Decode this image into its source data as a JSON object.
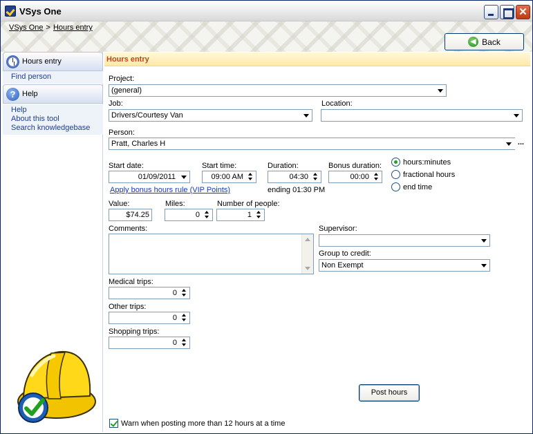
{
  "window": {
    "title": "VSys One"
  },
  "breadcrumb": {
    "home": "VSys One",
    "separator": ">",
    "current": "Hours entry"
  },
  "toolbar": {
    "back_label": "Back"
  },
  "sidebar": {
    "sections": [
      {
        "label": "Hours entry",
        "icon": "clock-icon",
        "links": [
          "Find person"
        ]
      },
      {
        "label": "Help",
        "icon": "help-icon",
        "links": [
          "Help",
          "About this tool",
          "Search knowledgebase"
        ]
      }
    ]
  },
  "page": {
    "title": "Hours entry"
  },
  "form": {
    "project": {
      "label": "Project:",
      "value": "(general)"
    },
    "job": {
      "label": "Job:",
      "value": "Drivers/Courtesy Van"
    },
    "location": {
      "label": "Location:",
      "value": ""
    },
    "person": {
      "label": "Person:",
      "value": "Pratt, Charles H",
      "browse_label": "..."
    },
    "start_date": {
      "label": "Start date:",
      "value": "01/09/2011"
    },
    "start_time": {
      "label": "Start time:",
      "value": "09:00 AM"
    },
    "duration": {
      "label": "Duration:",
      "value": "04:30",
      "ending_text": "ending 01:30 PM"
    },
    "bonus_duration": {
      "label": "Bonus duration:",
      "value": "00:00"
    },
    "duration_mode": {
      "options": [
        "hours:minutes",
        "fractional hours",
        "end time"
      ],
      "selected": "hours:minutes"
    },
    "bonus_rule_link": "Apply bonus hours rule (VIP Points)",
    "value": {
      "label": "Value:",
      "value": "$74.25"
    },
    "miles": {
      "label": "Miles:",
      "value": "0"
    },
    "number_of_people": {
      "label": "Number of people:",
      "value": "1"
    },
    "comments": {
      "label": "Comments:",
      "value": ""
    },
    "supervisor": {
      "label": "Supervisor:",
      "value": ""
    },
    "group_to_credit": {
      "label": "Group to credit:",
      "value": "Non Exempt"
    },
    "medical_trips": {
      "label": "Medical trips:",
      "value": "0"
    },
    "other_trips": {
      "label": "Other trips:",
      "value": "0"
    },
    "shopping_trips": {
      "label": "Shopping trips:",
      "value": "0"
    },
    "post_label": "Post hours",
    "warn": {
      "label": "Warn when posting more than 12 hours at a time",
      "checked": true
    }
  },
  "colors": {
    "header_text": "#c0451c",
    "link": "#1a35c8",
    "accent_green": "#21a121"
  }
}
